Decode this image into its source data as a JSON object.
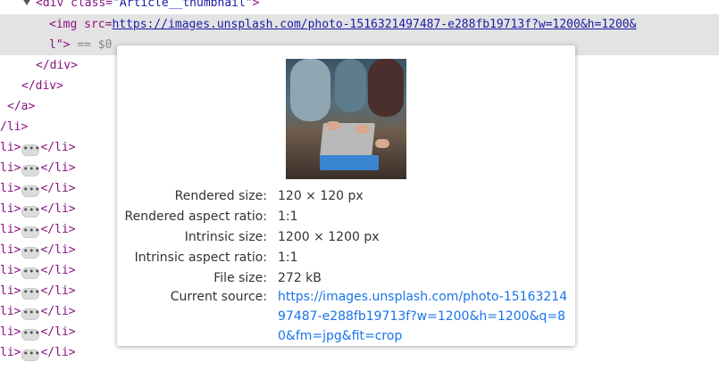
{
  "elements": {
    "line1": {
      "tag_open": "<div class=",
      "class_name": "\"Article__thumbnail\"",
      "tag_close": ">"
    },
    "line2": {
      "tag_open": "<img src=",
      "url": "https://images.unsplash.com/photo-1516321497487-e288fb19713f?w=1200&h=1200&"
    },
    "line3": {
      "text": "l\">",
      "eq": "== $0"
    },
    "lines": [
      "</div>",
      "</div>",
      "</a>",
      "/li>"
    ],
    "li_rows": [
      "li>",
      "</li>"
    ]
  },
  "tooltip": {
    "rows": [
      {
        "label": "Rendered size:",
        "value": "120 × 120 px"
      },
      {
        "label": "Rendered aspect ratio:",
        "value": "1:1"
      },
      {
        "label": "Intrinsic size:",
        "value": "1200 × 1200 px"
      },
      {
        "label": "Intrinsic aspect ratio:",
        "value": "1:1"
      },
      {
        "label": "File size:",
        "value": "272 kB"
      },
      {
        "label": "Current source:",
        "value": "https://images.unsplash.com/photo-1516321497487-e288fb19713f?w=1200&h=1200&q=80&fm=jpg&fit=crop"
      }
    ]
  },
  "colors": {
    "tag": "#881280",
    "attr": "#994500",
    "value": "#1a1aa6",
    "link": "#1a73e8"
  }
}
